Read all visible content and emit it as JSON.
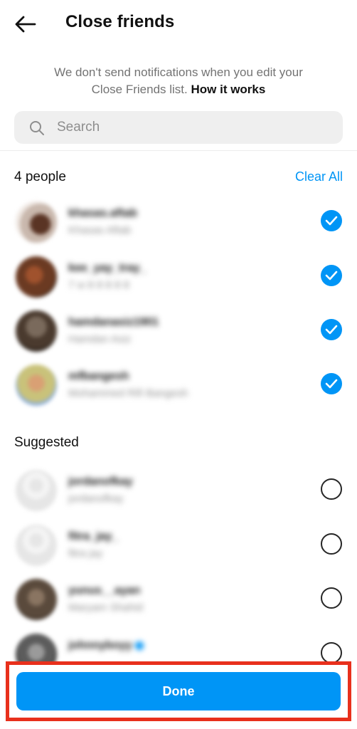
{
  "header": {
    "title": "Close friends"
  },
  "info": {
    "line1": "We don't send notifications when you edit your",
    "line2": "Close Friends list. ",
    "link": "How it works"
  },
  "search": {
    "placeholder": "Search"
  },
  "close_friends": {
    "count_label": "4 people",
    "clear_label": "Clear All",
    "people": [
      {
        "username": "khasas.aftab",
        "name": "Khasas Aftab",
        "selected": true
      },
      {
        "username": "kee_yay_tray_",
        "name": "7 w 8 8 8 8 8",
        "selected": true
      },
      {
        "username": "hamdanasiz1901",
        "name": "Hamdan Asiz",
        "selected": true
      },
      {
        "username": "mfbangesh",
        "name": "Mohammed Rifi Bangesh",
        "selected": true
      }
    ]
  },
  "suggested": {
    "title": "Suggested",
    "people": [
      {
        "username": "jordanofkay",
        "name": "jordanofkay",
        "selected": false
      },
      {
        "username": "fitra_jay_",
        "name": "fitra jay",
        "selected": false
      },
      {
        "username": "yunus__ayan",
        "name": "Maryam Shahid",
        "selected": false
      },
      {
        "username": "johnnyboyy",
        "name": "",
        "selected": false
      }
    ]
  },
  "footer": {
    "done_label": "Done"
  },
  "colors": {
    "accent": "#0095f6",
    "highlight": "#e8301c"
  }
}
